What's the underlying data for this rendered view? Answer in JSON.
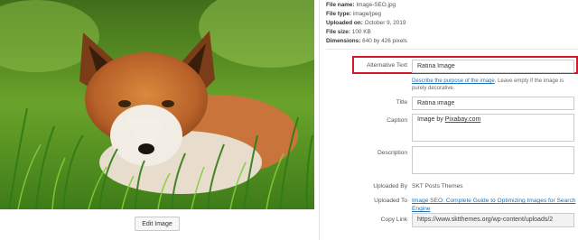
{
  "file_info": {
    "name_label": "File name:",
    "name_value": "Image-SEO.jpg",
    "type_label": "File type:",
    "type_value": "image/jpeg",
    "uploaded_label": "Uploaded on:",
    "uploaded_value": "October 9, 2019",
    "size_label": "File size:",
    "size_value": "100 KB",
    "dims_label": "Dimensions:",
    "dims_value": "640 by 426 pixels"
  },
  "alt": {
    "label": "Alternative Text",
    "value": "Ratina Image",
    "help_link": "Describe the purpose of the image",
    "help_rest": ". Leave empty if the image is purely decorative."
  },
  "title": {
    "label": "Title",
    "value": "Ratina image"
  },
  "caption": {
    "label": "Caption",
    "prefix": "Image by ",
    "link": "Pixabay.com"
  },
  "description": {
    "label": "Description",
    "value": ""
  },
  "uploaded_by": {
    "label": "Uploaded By",
    "value": "SKT Posts Themes"
  },
  "uploaded_to": {
    "label": "Uploaded To",
    "value": "Image SEO: Complete Guide to Optimizing Images for Search Engine"
  },
  "copy_link": {
    "label": "Copy Link",
    "value": "https://www.sktthemes.org/wp-content/uploads/2"
  },
  "preview": {
    "edit_button": "Edit Image"
  },
  "colors": {
    "highlight": "#d0192b",
    "link": "#2271b1"
  }
}
